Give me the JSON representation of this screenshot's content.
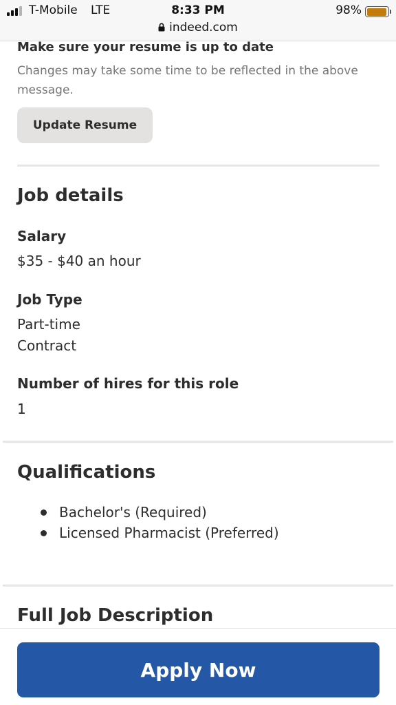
{
  "status_bar": {
    "carrier": "T-Mobile",
    "network": "LTE",
    "time": "8:33 PM",
    "battery_percent": "98%",
    "battery_level": 0.98,
    "battery_color": "#c47b0e",
    "url": "indeed.com"
  },
  "resume": {
    "title": "Make sure your resume is up to date",
    "note": "Changes may take some time to be reflected in the above message.",
    "update_button": "Update Resume"
  },
  "job_details": {
    "heading": "Job details",
    "salary_label": "Salary",
    "salary_value": "$35 - $40 an hour",
    "job_type_label": "Job Type",
    "job_types": [
      "Part-time",
      "Contract"
    ],
    "hires_label": "Number of hires for this role",
    "hires_value": "1"
  },
  "qualifications": {
    "heading": "Qualifications",
    "items": [
      "Bachelor's (Required)",
      "Licensed Pharmacist (Preferred)"
    ]
  },
  "description": {
    "heading": "Full Job Description"
  },
  "apply": {
    "label": "Apply Now",
    "color": "#2557a7"
  }
}
